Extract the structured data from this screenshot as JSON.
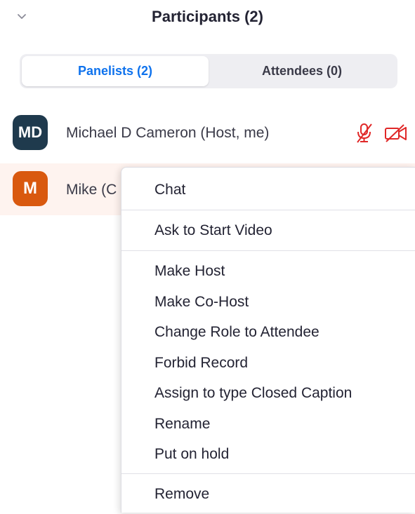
{
  "header": {
    "title": "Participants (2)"
  },
  "tabs": [
    {
      "label": "Panelists (2)",
      "active": true
    },
    {
      "label": "Attendees (0)",
      "active": false
    }
  ],
  "participants": [
    {
      "initials": "MD",
      "name": "Michael D Cameron (Host, me)",
      "avatar_color": "#1f3a4d",
      "audio": "muted-icon",
      "video": "video-off-icon"
    },
    {
      "initials": "M",
      "name": "Mike (C",
      "avatar_color": "#d9590f"
    }
  ],
  "context_menu": {
    "group1": [
      "Chat"
    ],
    "group2": [
      "Ask to Start Video"
    ],
    "group3": [
      "Make Host",
      "Make Co-Host",
      "Change Role to Attendee",
      "Forbid Record",
      "Assign to type Closed Caption",
      "Rename",
      "Put on hold"
    ],
    "group4": [
      "Remove"
    ]
  },
  "colors": {
    "accent": "#0e72ed",
    "danger": "#e02828",
    "hover_row": "#fef3ef"
  }
}
